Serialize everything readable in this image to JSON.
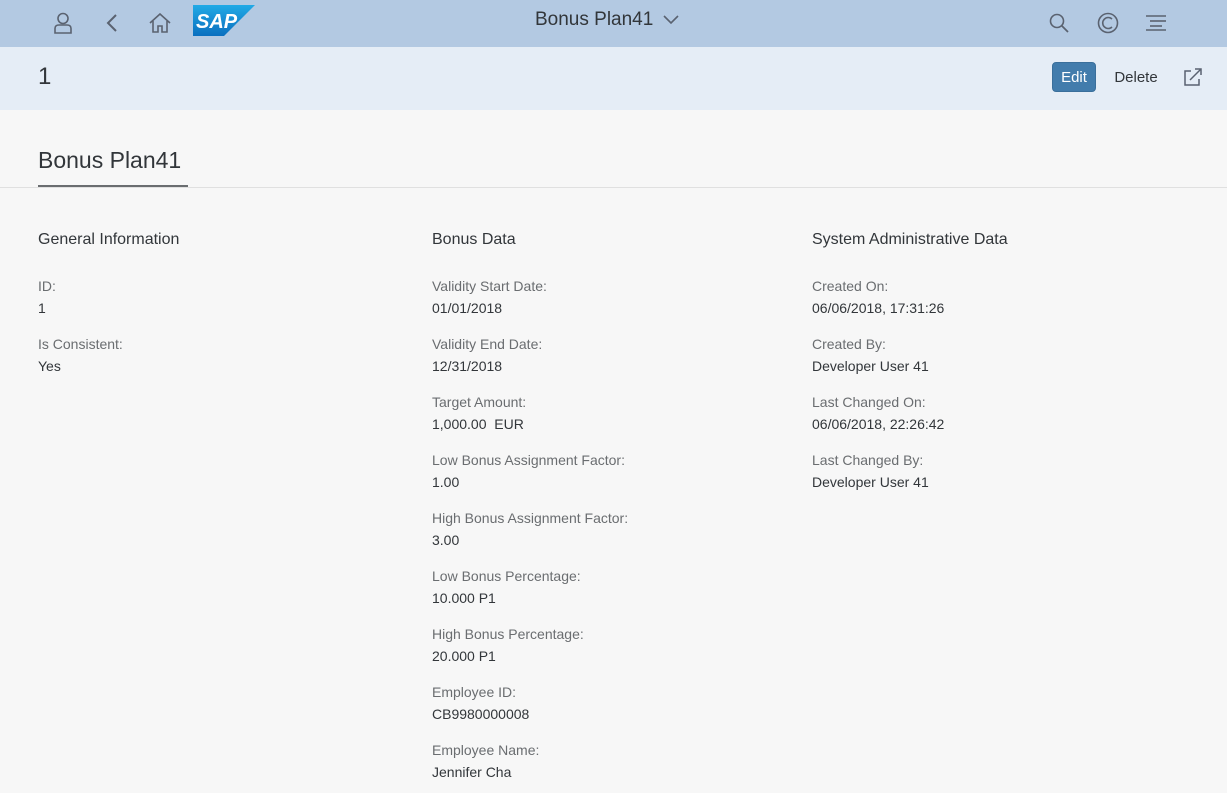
{
  "shell": {
    "title": "Bonus Plan41",
    "icons": {
      "user": "user-icon",
      "back": "back-icon",
      "home": "home-icon",
      "search": "search-icon",
      "copilot": "copilot-icon",
      "notifications": "notifications-icon"
    },
    "logo": "SAP"
  },
  "header": {
    "object_title": "1",
    "edit_label": "Edit",
    "delete_label": "Delete"
  },
  "section": {
    "tab_label": "Bonus Plan41"
  },
  "general": {
    "title": "General Information",
    "fields": [
      {
        "label": "ID:",
        "value": "1"
      },
      {
        "label": "Is Consistent:",
        "value": "Yes"
      }
    ]
  },
  "bonus": {
    "title": "Bonus Data",
    "fields": [
      {
        "label": "Validity Start Date:",
        "value": "01/01/2018"
      },
      {
        "label": "Validity End Date:",
        "value": "12/31/2018"
      },
      {
        "label": "Target Amount:",
        "value": "1,000.00  EUR"
      },
      {
        "label": "Low Bonus Assignment Factor:",
        "value": "1.00"
      },
      {
        "label": "High Bonus Assignment Factor:",
        "value": "3.00"
      },
      {
        "label": "Low Bonus Percentage:",
        "value": "10.000 P1"
      },
      {
        "label": "High Bonus Percentage:",
        "value": "20.000 P1"
      },
      {
        "label": "Employee ID:",
        "value": "CB9980000008"
      },
      {
        "label": "Employee Name:",
        "value": "Jennifer Cha"
      }
    ]
  },
  "admin": {
    "title": "System Administrative Data",
    "fields": [
      {
        "label": "Created On:",
        "value": "06/06/2018, 17:31:26"
      },
      {
        "label": "Created By:",
        "value": "Developer User 41"
      },
      {
        "label": "Last Changed On:",
        "value": "06/06/2018, 22:26:42"
      },
      {
        "label": "Last Changed By:",
        "value": "Developer User 41"
      }
    ]
  },
  "colors": {
    "shell_bg": "#b3c9e2",
    "header_bg": "#e5edf6",
    "emphasized_button": "#427cac",
    "sap_logo_blue": "#1a8fd6"
  }
}
